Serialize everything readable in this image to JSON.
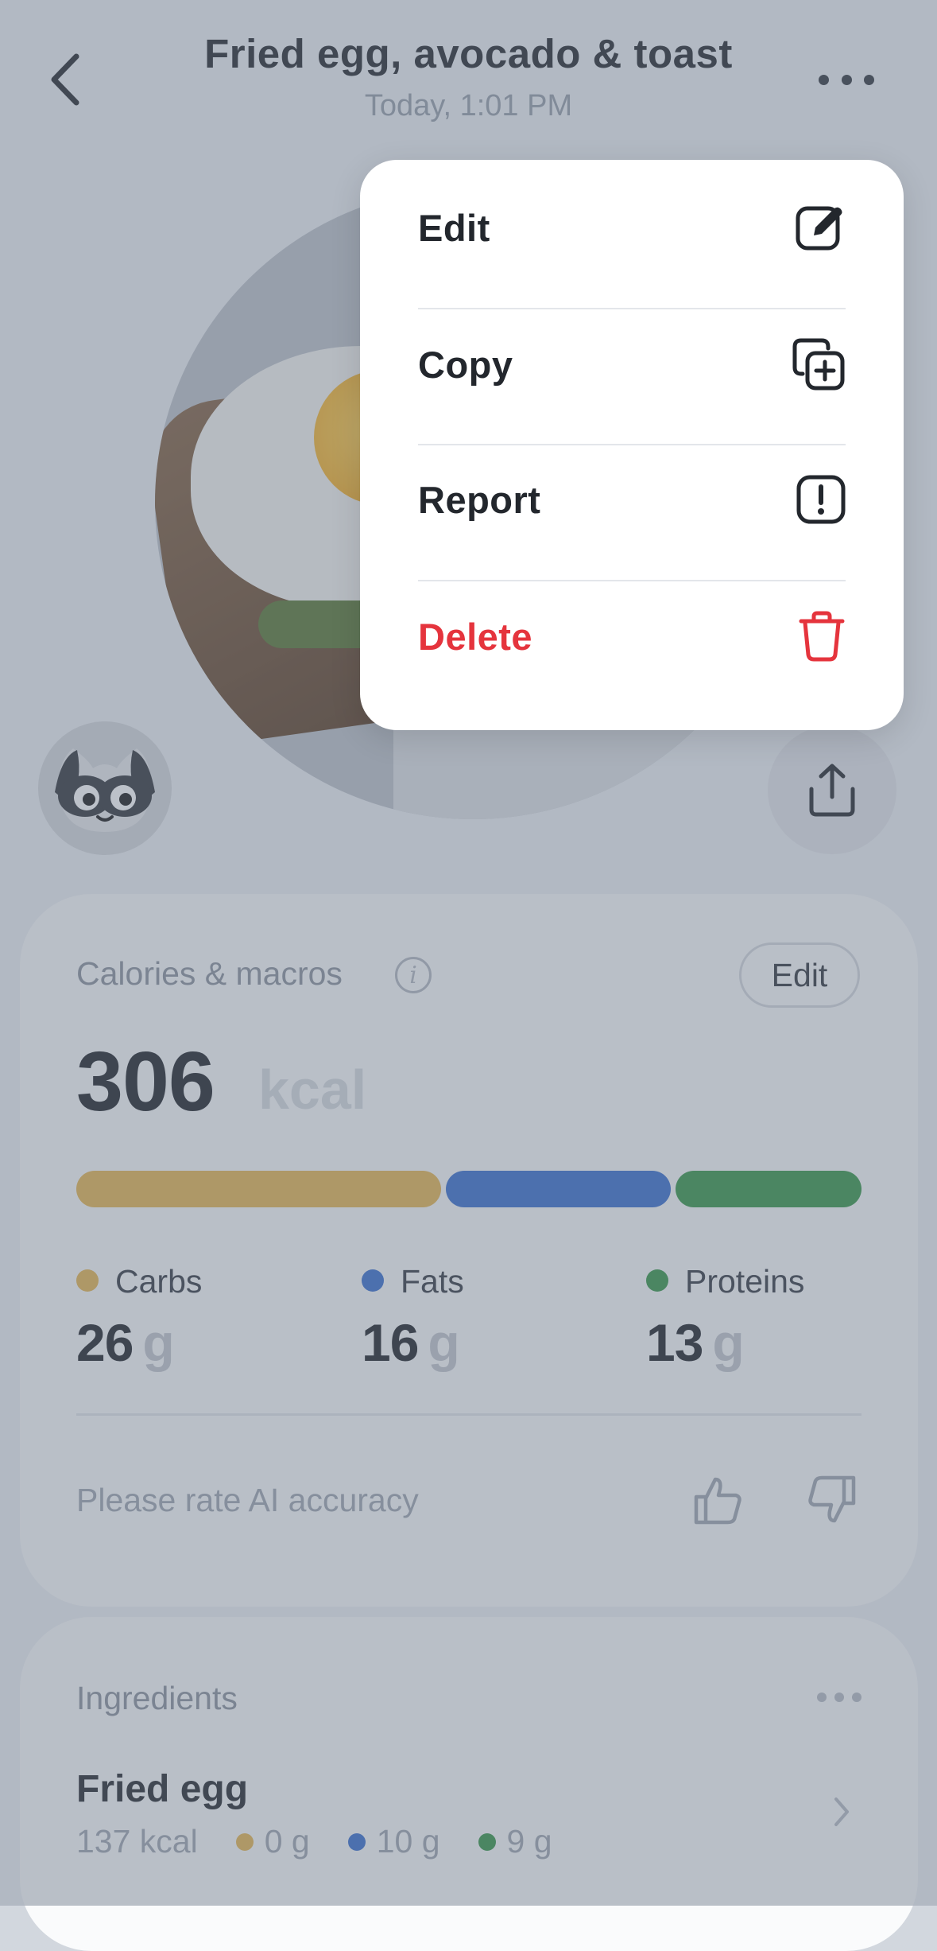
{
  "header": {
    "title": "Fried egg, avocado & toast",
    "subtitle": "Today, 1:01 PM"
  },
  "nutrition": {
    "section_title": "Calories & macros",
    "edit_label": "Edit",
    "calories": "306",
    "calories_unit": "kcal",
    "macro_split": [
      0.47,
      0.29,
      0.24
    ],
    "macros": [
      {
        "label": "Carbs",
        "value": "26",
        "unit": "g",
        "color": "#e7b856"
      },
      {
        "label": "Fats",
        "value": "16",
        "unit": "g",
        "color": "#3f74d0"
      },
      {
        "label": "Proteins",
        "value": "13",
        "unit": "g",
        "color": "#3d9a4e"
      }
    ],
    "rate_prompt": "Please rate AI accuracy"
  },
  "ingredients": {
    "section_title": "Ingredients",
    "items": [
      {
        "name": "Fried egg",
        "kcal": "137 kcal",
        "carbs": "0 g",
        "fats": "10 g",
        "proteins": "9 g"
      }
    ]
  },
  "menu": {
    "items": [
      {
        "label": "Edit",
        "icon": "edit-icon"
      },
      {
        "label": "Copy",
        "icon": "copy-icon"
      },
      {
        "label": "Report",
        "icon": "report-icon"
      },
      {
        "label": "Delete",
        "icon": "trash-icon",
        "color": "#e5343d"
      }
    ]
  }
}
